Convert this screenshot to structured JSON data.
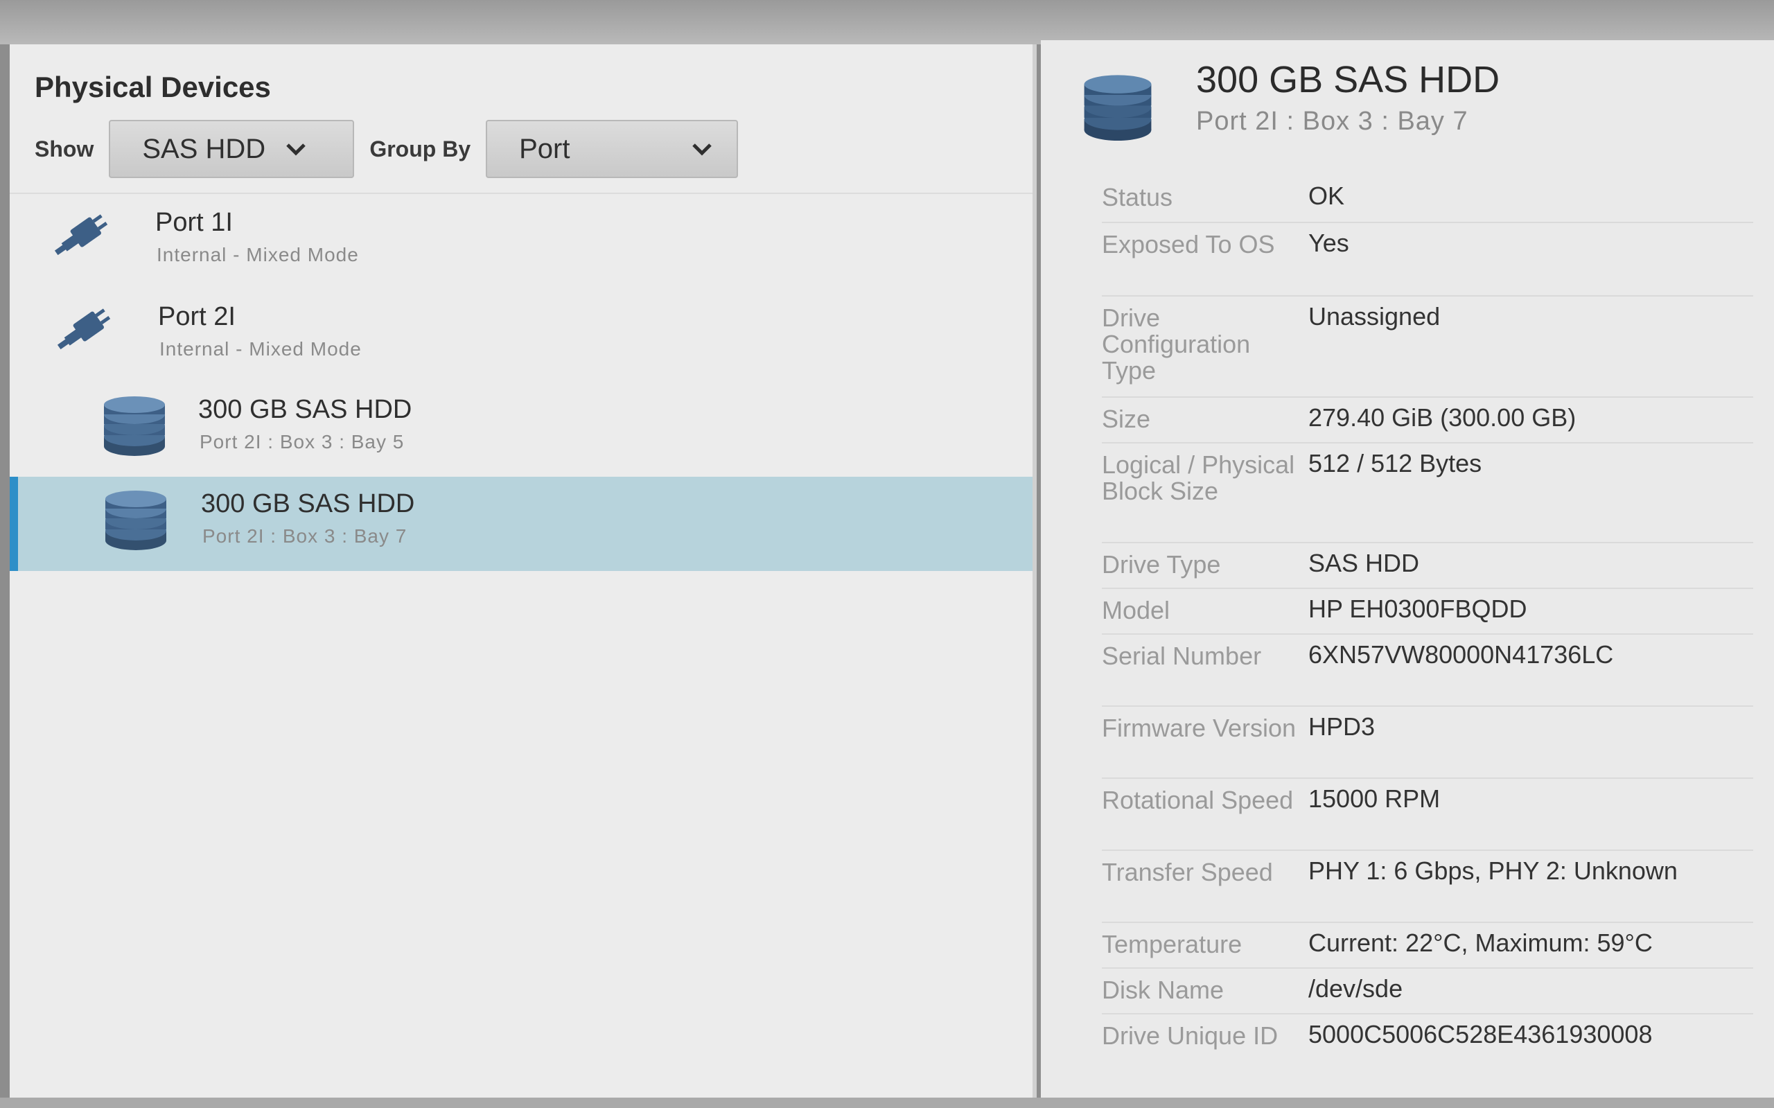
{
  "left": {
    "title": "Physical Devices",
    "show_label": "Show",
    "show_value": "SAS HDD",
    "group_label": "Group By",
    "group_value": "Port",
    "items": [
      {
        "icon": "cable-plug-icon",
        "name": "Port 1I",
        "sub": "Internal - Mixed Mode"
      },
      {
        "icon": "cable-plug-icon",
        "name": "Port 2I",
        "sub": "Internal - Mixed Mode"
      },
      {
        "icon": "disk-stack-icon",
        "name": "300 GB SAS HDD",
        "sub": "Port 2I : Box 3 : Bay 5"
      },
      {
        "icon": "disk-stack-icon",
        "name": "300 GB SAS HDD",
        "sub": "Port 2I : Box 3 : Bay 7",
        "selected": true
      }
    ]
  },
  "detail": {
    "icon": "disk-stack-icon",
    "title": "300 GB SAS HDD",
    "subtitle": "Port 2I : Box 3 : Bay 7",
    "properties": [
      {
        "key": "Status",
        "value": "OK"
      },
      {
        "key": "Exposed To OS",
        "value": "Yes"
      },
      {
        "key": "Drive Configuration Type",
        "value": "Unassigned"
      },
      {
        "key": "Size",
        "value": "279.40 GiB (300.00 GB)"
      },
      {
        "key": "Logical / Physical Block Size",
        "value": "512 / 512 Bytes"
      },
      {
        "key": "Drive Type",
        "value": "SAS HDD"
      },
      {
        "key": "Model",
        "value": "HP EH0300FBQDD"
      },
      {
        "key": "Serial Number",
        "value": "6XN57VW80000N41736LC"
      },
      {
        "key": "Firmware Version",
        "value": "HPD3"
      },
      {
        "key": "Rotational Speed",
        "value": "15000 RPM"
      },
      {
        "key": "Transfer Speed",
        "value": "PHY 1: 6 Gbps, PHY 2: Unknown"
      },
      {
        "key": "Temperature",
        "value": "Current: 22°C, Maximum: 59°C"
      },
      {
        "key": "Disk Name",
        "value": "/dev/sde"
      },
      {
        "key": "Drive Unique ID",
        "value": "5000C5006C528E4361930008"
      }
    ]
  },
  "colors": {
    "selected_bg": "#b7d3dc",
    "selected_accent": "#2e8fc8",
    "icon_blue": "#3d5f86"
  }
}
